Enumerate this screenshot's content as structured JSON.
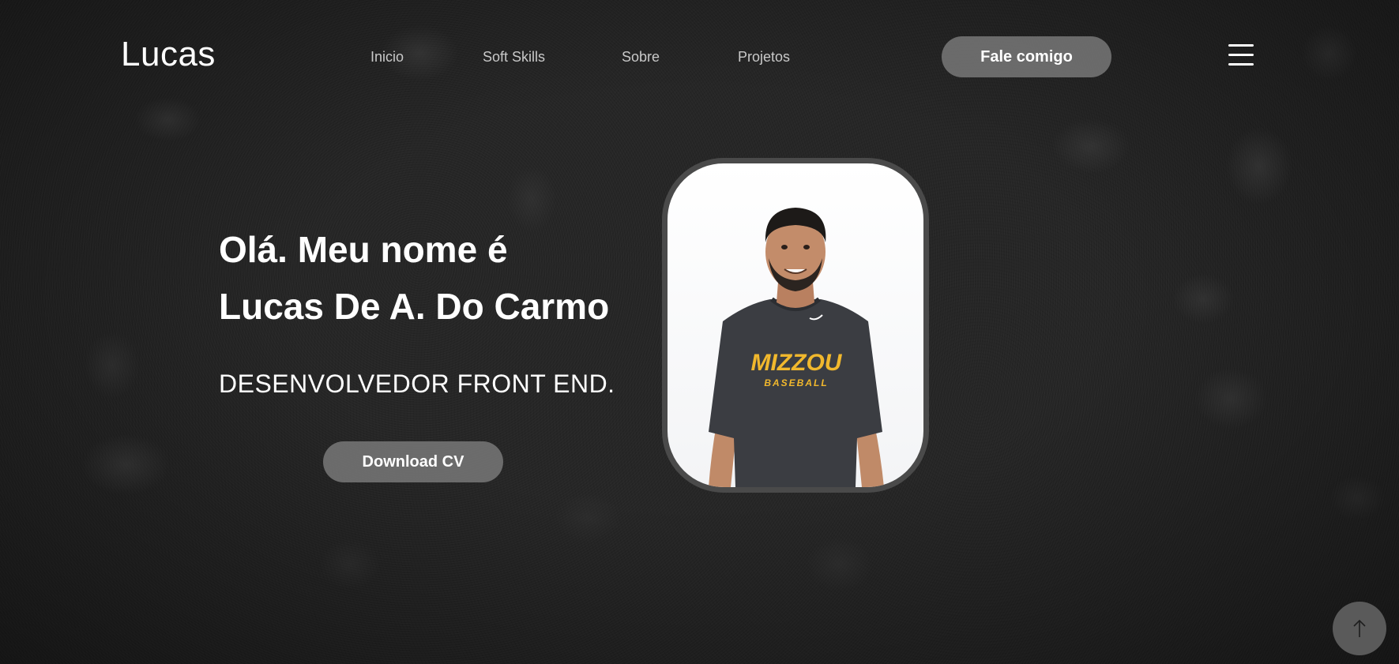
{
  "header": {
    "logo": "Lucas",
    "nav": [
      {
        "label": "Inicio"
      },
      {
        "label": "Soft Skills"
      },
      {
        "label": "Sobre"
      },
      {
        "label": "Projetos"
      }
    ],
    "cta_label": "Fale comigo",
    "menu_icon": "hamburger-menu-icon"
  },
  "hero": {
    "title_line1": "Olá. Meu nome é",
    "title_line2": "Lucas De A. Do Carmo",
    "role": "DESENVOLVEDOR FRONT END.",
    "download_label": "Download CV"
  },
  "photo": {
    "shirt_text_1": "MIZZOU",
    "shirt_text_2": "BASEBALL"
  },
  "scroll_top_icon": "arrow-up-icon",
  "colors": {
    "background": "#262626",
    "button": "#787878",
    "text": "#ffffff",
    "nav_text": "#c9c9c9",
    "shirt_accent": "#f1b82d"
  }
}
